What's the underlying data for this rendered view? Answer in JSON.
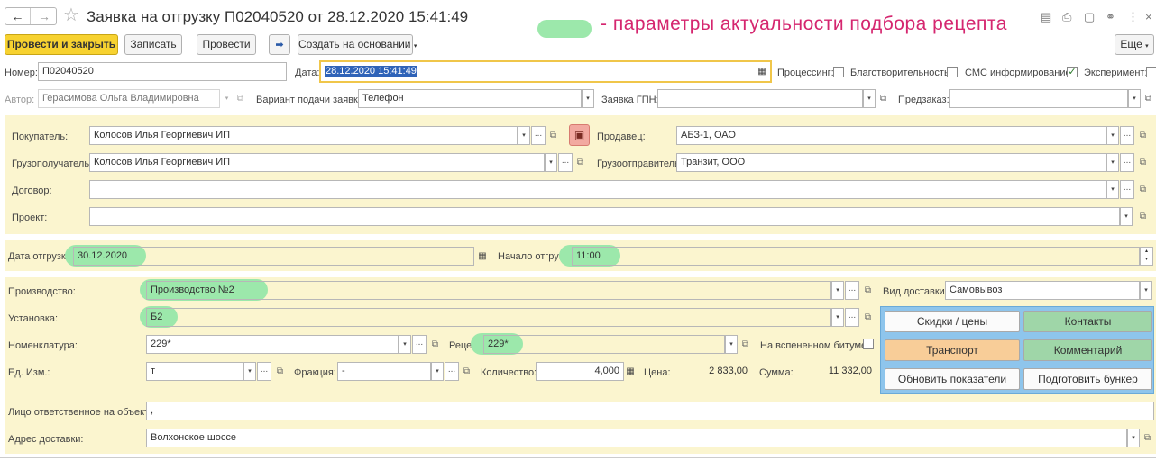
{
  "window": {
    "title": "Заявка на отгрузку П02040520 от 28.12.2020 15:41:49",
    "annotation": "- параметры актуальности подбора рецепта"
  },
  "toolbar": {
    "post_close": "Провести и закрыть",
    "save": "Записать",
    "post": "Провести",
    "create_based": "Создать на основании",
    "more": "Еще"
  },
  "header": {
    "number_label": "Номер:",
    "number_value": "П02040520",
    "date_label": "Дата:",
    "date_value": "28.12.2020 15:41:49",
    "processing_label": "Процессинг:",
    "processing_checked": false,
    "charity_label": "Благотворительность:",
    "charity_checked": false,
    "sms_label": "СМС информирование:",
    "sms_checked": true,
    "experiment_label": "Эксперимент:",
    "experiment_checked": false,
    "author_label": "Автор:",
    "author_value": "Герасимова Ольга Владимировна",
    "variant_label": "Вариант подачи заявки:",
    "variant_value": "Телефон",
    "gpn_label": "Заявка ГПН:",
    "gpn_value": "",
    "preorder_label": "Предзаказ:",
    "preorder_value": ""
  },
  "parties": {
    "buyer_label": "Покупатель:",
    "buyer_value": "Колосов Илья Георгиевич ИП",
    "consignee_label": "Грузополучатель:",
    "consignee_value": "Колосов Илья Георгиевич ИП",
    "contract_label": "Договор:",
    "contract_value": "",
    "project_label": "Проект:",
    "project_value": "",
    "seller_label": "Продавец:",
    "seller_value": "АБЗ-1, ОАО",
    "shipper_label": "Грузоотправитель:",
    "shipper_value": "Транзит, ООО"
  },
  "shipment": {
    "date_label": "Дата отгрузки:",
    "date_value": "30.12.2020",
    "start_label": "Начало отгрузки:",
    "start_value": "11:00"
  },
  "production": {
    "production_label": "Производство:",
    "production_value": "Производство №2",
    "unit_label": "Установка:",
    "unit_value": "Б2",
    "nomenclature_label": "Номенклатура:",
    "nomenclature_value": "229*",
    "recipe_label": "Рецепт:",
    "recipe_value": "229*",
    "foamed_label": "На вспененном битуме:",
    "foamed_checked": false,
    "uom_label": "Ед. Изм.:",
    "uom_value": "т",
    "fraction_label": "Фракция:",
    "fraction_value": "-",
    "qty_label": "Количество:",
    "qty_value": "4,000",
    "price_label": "Цена:",
    "price_value": "2 833,00",
    "sum_label": "Сумма:",
    "sum_value": "11 332,00",
    "delivery_label": "Вид доставки:",
    "delivery_value": "Самовывоз",
    "responsible_label": "Лицо ответственное на объекте:",
    "responsible_value": ",",
    "address_label": "Адрес доставки:",
    "address_value": "Волхонское шоссе"
  },
  "side_buttons": {
    "discounts": "Скидки / цены",
    "contacts": "Контакты",
    "transport": "Транспорт",
    "comment": "Комментарий",
    "refresh": "Обновить показатели",
    "bunker": "Подготовить бункер"
  },
  "colors": {
    "primary_button": "#f7d230",
    "highlight": "#9ce8ab",
    "panel": "#fbf5cf",
    "annotation": "#d5266f",
    "side_panel": "#8ec5ec"
  }
}
